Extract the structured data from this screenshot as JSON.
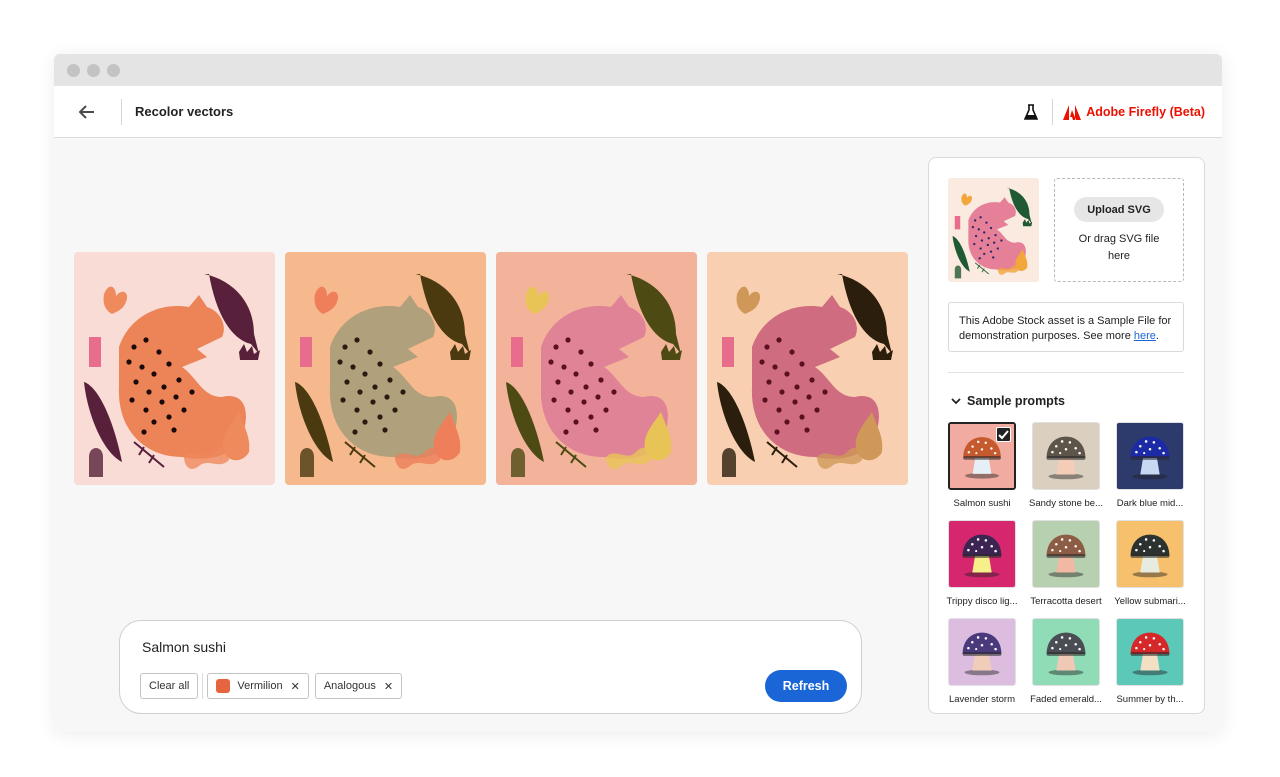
{
  "window": {
    "controls": [
      "close",
      "minimize",
      "maximize"
    ]
  },
  "header": {
    "back_icon": "arrow-left-icon",
    "title": "Recolor vectors",
    "labs_icon": "flask-icon",
    "brand_logo": "adobe-logo-icon",
    "brand_name": "Adobe Firefly (Beta)",
    "brand_color": "#eb1000"
  },
  "results": [
    {
      "name": "variation-1",
      "background": "#f9dcd5",
      "cat": "#ec8458",
      "leaf": "#58203a",
      "accent": "#ef8a5c",
      "spots": "#1a0a0a"
    },
    {
      "name": "variation-2",
      "background": "#f6b98e",
      "cat": "#b0a07c",
      "leaf": "#4b3a10",
      "accent": "#ef7e5a",
      "spots": "#2a1a10"
    },
    {
      "name": "variation-3",
      "background": "#f3b39a",
      "cat": "#e08396",
      "leaf": "#4e4a14",
      "accent": "#e8c456",
      "spots": "#5a1020"
    },
    {
      "name": "variation-4",
      "background": "#f9cfb2",
      "cat": "#cf6c80",
      "leaf": "#2c1e0c",
      "accent": "#cf9858",
      "spots": "#5a1020"
    }
  ],
  "prompt": {
    "text": "Salmon sushi",
    "clear_label": "Clear all",
    "tags": [
      {
        "label": "Vermilion",
        "swatch": "#e4653f",
        "remove_icon": "close-icon"
      },
      {
        "label": "Analogous",
        "remove_icon": "close-icon"
      }
    ],
    "refresh_label": "Refresh",
    "accent": "#1a66d6"
  },
  "panel": {
    "upload_label": "Upload SVG",
    "drag_text": "Or drag SVG file here",
    "notice_text": "This Adobe Stock asset is a Sample File for demonstration purposes. See more ",
    "notice_link": "here",
    "notice_end": ".",
    "section_title": "Sample prompts",
    "samples": [
      {
        "label": "Salmon sushi",
        "bg": "#f1aba0",
        "cap": "#c55a2e",
        "stem": "#e6eef6",
        "selected": true
      },
      {
        "label": "Sandy stone be...",
        "bg": "#dbcfc0",
        "cap": "#5e554a",
        "stem": "#f4cdb8",
        "selected": false
      },
      {
        "label": "Dark blue mid...",
        "bg": "#2d3a6c",
        "cap": "#1c2aa6",
        "stem": "#c9d8f2",
        "selected": false
      },
      {
        "label": "Trippy disco lig...",
        "bg": "#d6276e",
        "cap": "#3c2552",
        "stem": "#f5f08a",
        "selected": false
      },
      {
        "label": "Terracotta desert",
        "bg": "#b7d0b0",
        "cap": "#8d5c44",
        "stem": "#f1b9a3",
        "selected": false
      },
      {
        "label": "Yellow submari...",
        "bg": "#f6c06c",
        "cap": "#2c3230",
        "stem": "#e8ece0",
        "selected": false
      },
      {
        "label": "Lavender storm",
        "bg": "#dcbde0",
        "cap": "#4a3a7c",
        "stem": "#f0cdb8",
        "selected": false
      },
      {
        "label": "Faded emerald...",
        "bg": "#8fdcb6",
        "cap": "#4a4e54",
        "stem": "#f0c8b6",
        "selected": false
      },
      {
        "label": "Summer by th...",
        "bg": "#5cc8b8",
        "cap": "#d62828",
        "stem": "#f3dfc4",
        "selected": false
      }
    ]
  }
}
